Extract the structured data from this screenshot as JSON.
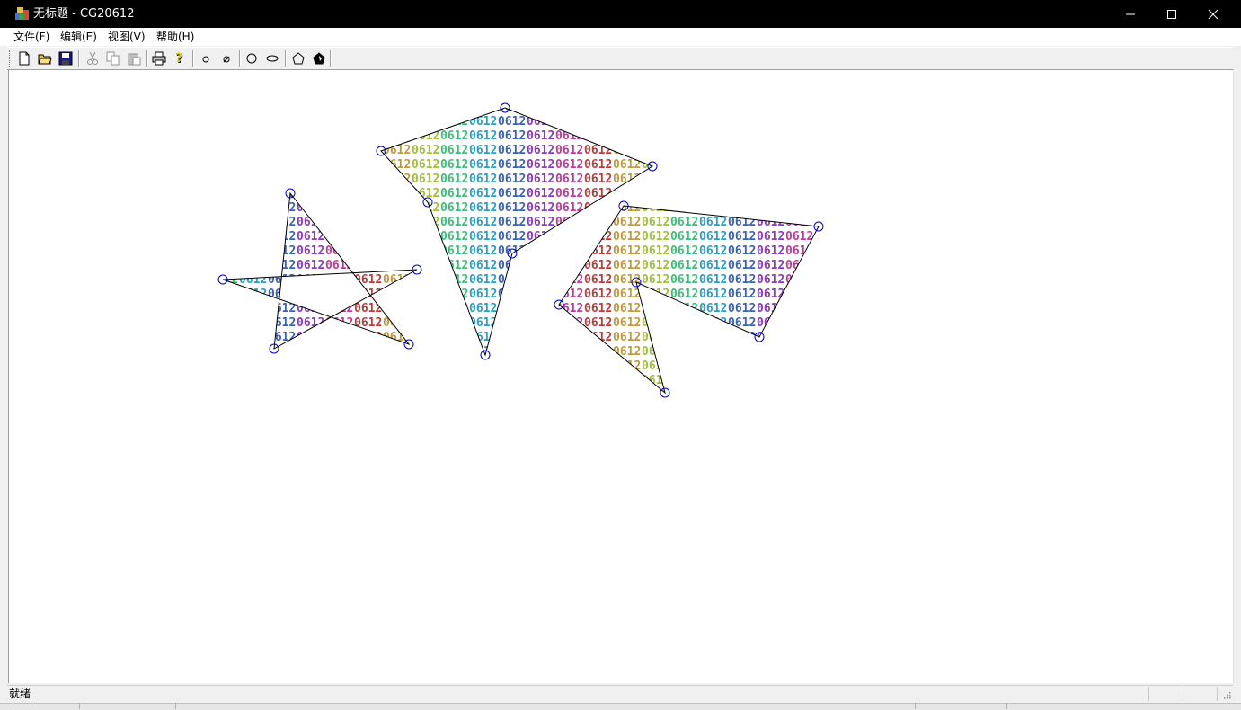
{
  "window": {
    "title": "无标题 - CG20612"
  },
  "menu": {
    "items": [
      "文件(F)",
      "编辑(E)",
      "视图(V)",
      "帮助(H)"
    ]
  },
  "toolbar": {
    "buttons": [
      "new-icon",
      "open-icon",
      "save-icon",
      "cut-icon",
      "copy-icon",
      "paste-icon",
      "print-icon",
      "help-icon",
      "small-circle-icon",
      "slashed-circle-icon",
      "circle-icon",
      "ellipse-icon",
      "polygon-icon",
      "fill-polygon-icon"
    ]
  },
  "canvas": {
    "fill_pattern_text": "0612",
    "pattern_colors": [
      "#2a9fc0",
      "#3a5fc0",
      "#8a3ac0",
      "#c03a9a",
      "#c03a3a",
      "#c09a3a",
      "#a0c03a",
      "#3ac07a"
    ],
    "vertex_marker_color": "#0000cc",
    "edge_color": "#000000"
  },
  "statusbar": {
    "text": "就绪"
  }
}
